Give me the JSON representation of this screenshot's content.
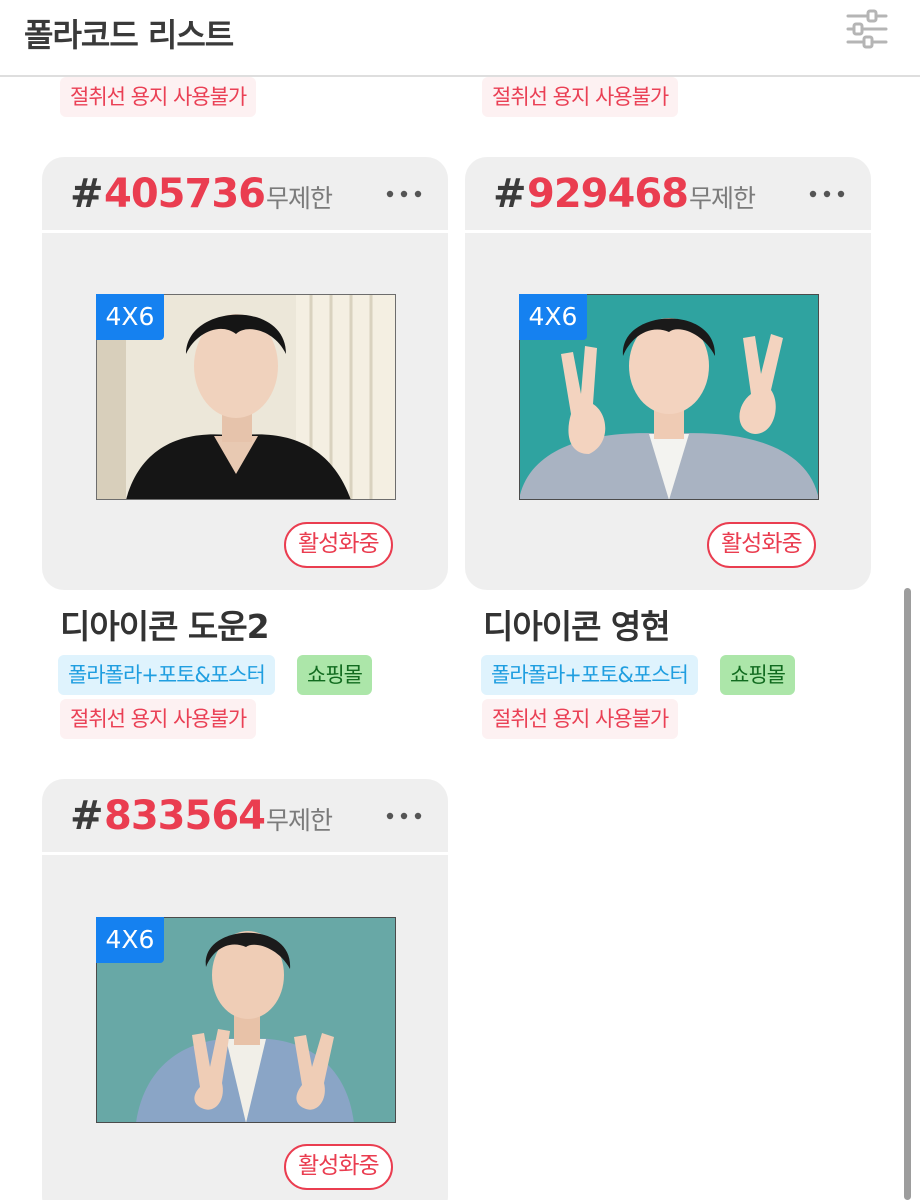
{
  "header": {
    "title": "폴라코드 리스트",
    "filter_icon": "sliders-icon"
  },
  "top_tags": [
    "절취선 용지 사용불가",
    "절취선 용지 사용불가"
  ],
  "cards": [
    {
      "hash": "#",
      "code": "405736",
      "limit": "무제한",
      "size": "4X6",
      "status": "활성화중",
      "name": "디아이콘 도운2",
      "tags": [
        "폴라폴라+포토&포스터",
        "쇼핑몰"
      ],
      "warning": "절취선 용지 사용불가"
    },
    {
      "hash": "#",
      "code": "929468",
      "limit": "무제한",
      "size": "4X6",
      "status": "활성화중",
      "name": "디아이콘 영현",
      "tags": [
        "폴라폴라+포토&포스터",
        "쇼핑몰"
      ],
      "warning": "절취선 용지 사용불가"
    },
    {
      "hash": "#",
      "code": "833564",
      "limit": "무제한",
      "size": "4X6",
      "status": "활성화중"
    }
  ],
  "colors": {
    "accent": "#ea3d50",
    "badge_blue": "#1581f0",
    "card_bg": "#efefef"
  }
}
